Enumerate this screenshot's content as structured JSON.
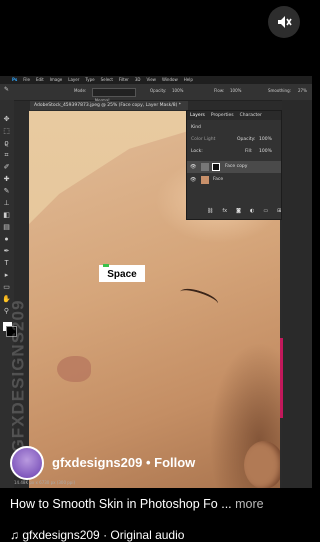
{
  "photoshop": {
    "menu": [
      "Ps",
      "File",
      "Edit",
      "Image",
      "Layer",
      "Type",
      "Select",
      "Filter",
      "3D",
      "View",
      "Window",
      "Help"
    ],
    "options": {
      "mode_label": "Mode:",
      "mode_value": "Normal",
      "opacity_label": "Opacity:",
      "opacity_value": "100%",
      "flow_label": "Flow:",
      "flow_value": "100%",
      "smoothing_label": "Smoothing:",
      "smoothing_value": "27%"
    },
    "document_tab": "AdobeStock_459397873.jpeg @ 25% (Face copy, Layer Mask/8) *",
    "layers_panel": {
      "tabs": [
        "Layers",
        "Properties",
        "Character"
      ],
      "kind_label": "Kind",
      "blend_mode": "Color Light",
      "opacity_label": "Opacity:",
      "opacity_value": "100%",
      "lock_label": "Lock:",
      "fill_label": "Fill:",
      "fill_value": "100%",
      "layers": [
        {
          "name": "Face copy",
          "selected": true
        },
        {
          "name": "Face",
          "selected": false
        }
      ]
    },
    "status": "14.48K px x 6730 px (300 ppi)",
    "key_overlay": "Space"
  },
  "watermark": "GFXDESIGNS209",
  "reel": {
    "creator": "gfxdesigns209",
    "separator": "•",
    "follow": "Follow",
    "caption": "How to Smooth Skin in Photoshop Fo ...",
    "more": "more",
    "audio": "gfxdesigns209 · Original audio",
    "mute_icon": "speaker-muted-icon"
  }
}
